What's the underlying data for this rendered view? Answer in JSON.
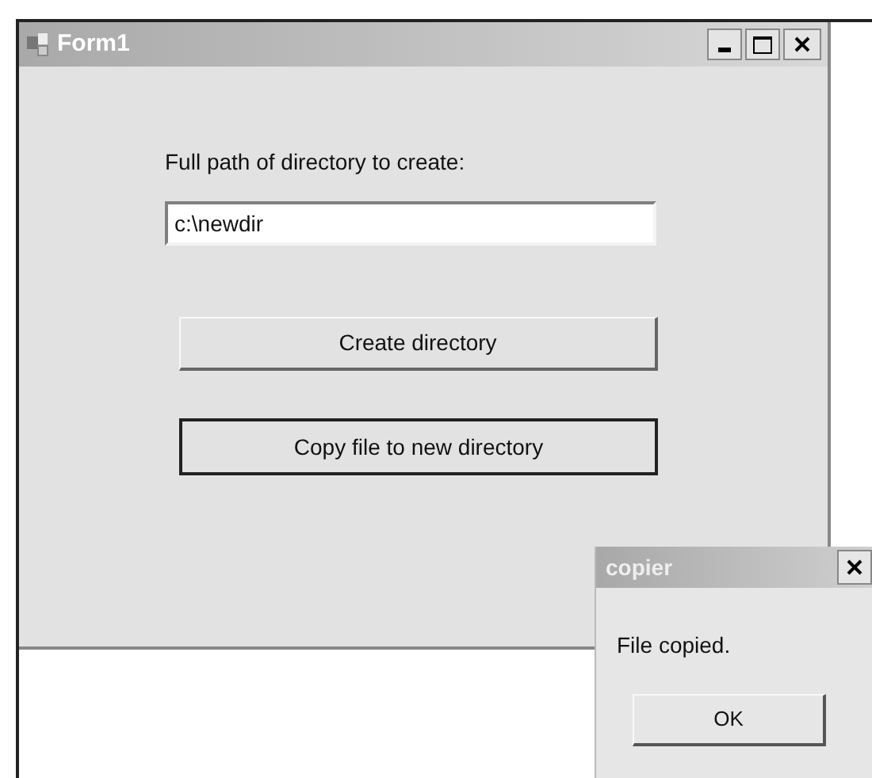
{
  "main_window": {
    "title": "Form1",
    "path_label": "Full path of directory to create:",
    "path_field": {
      "value": "c:\\newdir"
    },
    "buttons": [
      {
        "label": "Create directory",
        "focused": false
      },
      {
        "label": "Copy file to new directory",
        "focused": true
      }
    ]
  },
  "dialog": {
    "title": "copier",
    "message": "File copied.",
    "button": "OK"
  }
}
